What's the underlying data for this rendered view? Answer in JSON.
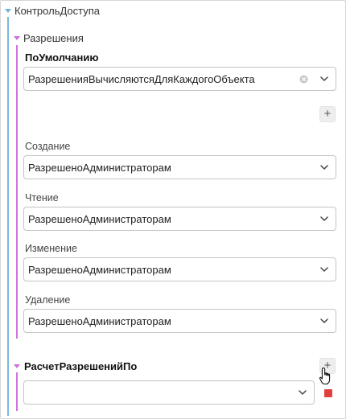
{
  "tree": {
    "root_label": "КонтрольДоступа",
    "permissions": {
      "label": "Разрешения",
      "default": {
        "label": "ПоУмолчанию",
        "value": "РазрешенияВычисляютсяДляКаждогоОбъекта"
      },
      "fields": [
        {
          "label": "Создание",
          "value": "РазрешеноАдминистраторам"
        },
        {
          "label": "Чтение",
          "value": "РазрешеноАдминистраторам"
        },
        {
          "label": "Изменение",
          "value": "РазрешеноАдминистраторам"
        },
        {
          "label": "Удаление",
          "value": "РазрешеноАдминистраторам"
        }
      ]
    },
    "calc_by": {
      "label": "РасчетРазрешенийПо",
      "value": ""
    }
  },
  "buttons": {
    "add_glyph": "+"
  },
  "icons": {
    "expand": "triangle-down-icon",
    "dropdown": "chevron-down-icon",
    "clear": "clear-circle-icon",
    "delete": "delete-icon",
    "cursor": "hand-pointer-icon"
  },
  "colors": {
    "root_branch": "#7db9dd",
    "child_branch": "#cf74dd",
    "delete": "#e04040"
  }
}
